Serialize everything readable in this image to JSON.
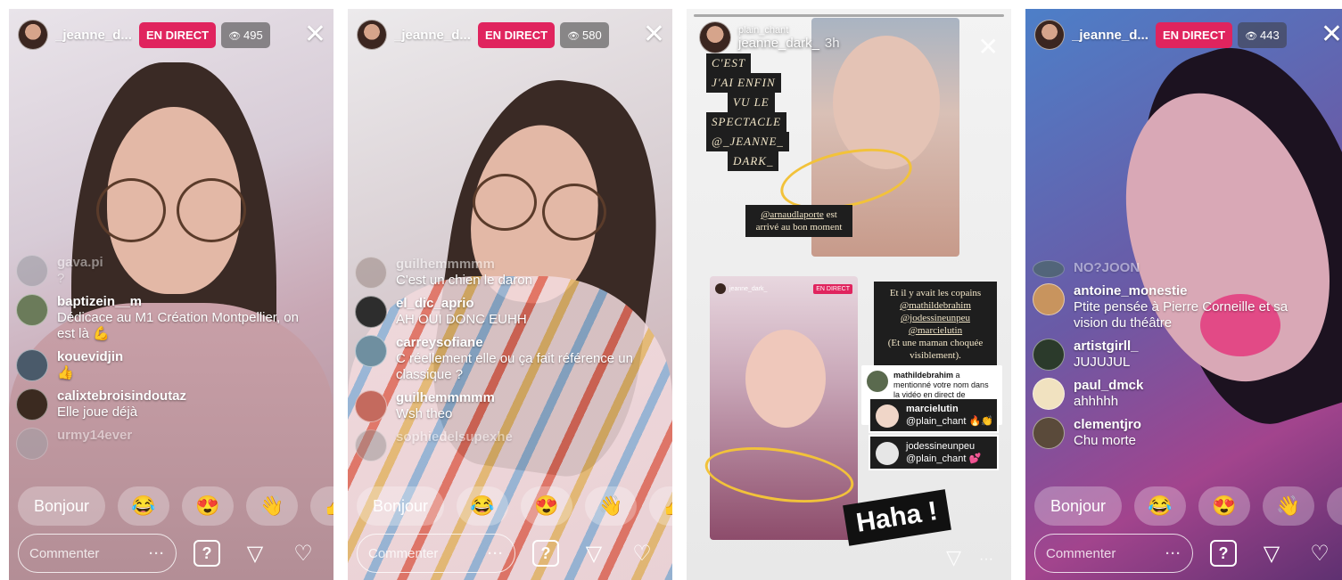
{
  "panels": [
    {
      "username": "_jeanne_d...",
      "live_label": "EN DIRECT",
      "views": "495",
      "comments": [
        {
          "user": "gava.pi",
          "text": "?",
          "faded": true
        },
        {
          "user": "baptizein__m",
          "text": "Dédicace au M1 Création Montpellier, on est là 💪"
        },
        {
          "user": "kouevidjin",
          "text": "👍"
        },
        {
          "user": "calixtebroisindoutaz",
          "text": "Elle joue déjà"
        },
        {
          "user": "urmy14ever",
          "text": "",
          "faded": true
        }
      ],
      "quick_text": "Bonjour",
      "quick_emojis": [
        "😂",
        "😍",
        "👋",
        "👍"
      ],
      "comment_placeholder": "Commenter",
      "comment_dots": "···"
    },
    {
      "username": "_jeanne_d...",
      "live_label": "EN DIRECT",
      "views": "580",
      "comments": [
        {
          "user": "guilhemmmmm",
          "text": "C'est un chien le daron",
          "faded_user": true
        },
        {
          "user": "el_dic_aprio",
          "text": "AH OUI DONC EUHH"
        },
        {
          "user": "carreysofiane",
          "text": "C réellement elle ou ça fait référence un classique ?"
        },
        {
          "user": "guilhemmmmm",
          "text": "Wsh theo"
        },
        {
          "user": "sophiedelsupexhe",
          "text": "",
          "faded": true
        }
      ],
      "quick_text": "Bonjour",
      "quick_emojis": [
        "😂",
        "😍",
        "👋",
        "👍"
      ],
      "comment_placeholder": "Commenter",
      "comment_dots": "···"
    },
    {
      "story_sub": "plain_chant",
      "story_user": "jeanne_dark_",
      "story_time": "3h",
      "title_lines": [
        "C'EST",
        "J'AI ENFIN",
        "VU LE",
        "SPECTACLE",
        "@_JEANNE_",
        "DARK_"
      ],
      "arrived_user": "@arnaudlaporte",
      "arrived_text": "est arrivé au bon moment",
      "copains_intro": "Et il y avait les copains",
      "copains_users": [
        "@mathildebrahim",
        "@jodessineunpeu",
        "@marcielutin"
      ],
      "copains_note": "(Et une maman choquée visiblement).",
      "mention_user": "mathildebrahim",
      "mention_text": "a mentionné votre nom dans la vidéo en direct de _jeanne_dar Oh @plain_chant.",
      "tags": [
        {
          "user": "marcielutin",
          "mention": "@plain_chant 🔥👏"
        },
        {
          "user": "jodessineunpeu",
          "mention": "@plain_chant 💕"
        }
      ],
      "haha": "Haha !",
      "more_dots": "···"
    },
    {
      "username": "_jeanne_d...",
      "live_label": "EN DIRECT",
      "views": "443",
      "comments": [
        {
          "user": "NO?JOON",
          "text": "",
          "faded": true
        },
        {
          "user": "antoine_monestie",
          "text": "Ptite pensée à Pierre Corneille et sa vision du théâtre"
        },
        {
          "user": "artistgirll_",
          "text": "JUJUJUL"
        },
        {
          "user": "paul_dmck",
          "text": "ahhhhh"
        },
        {
          "user": "clementjro",
          "text": "Chu morte"
        }
      ],
      "quick_text": "Bonjour",
      "quick_emojis": [
        "😂",
        "😍",
        "👋",
        "👍"
      ],
      "comment_placeholder": "Commenter",
      "comment_dots": "···"
    }
  ],
  "icons": {
    "eye": "👁",
    "close": "✕",
    "question": "?",
    "send": "▽",
    "heart": "♡"
  },
  "colors": {
    "live_badge": "#e0245e",
    "story_accent": "#f2c23a"
  }
}
